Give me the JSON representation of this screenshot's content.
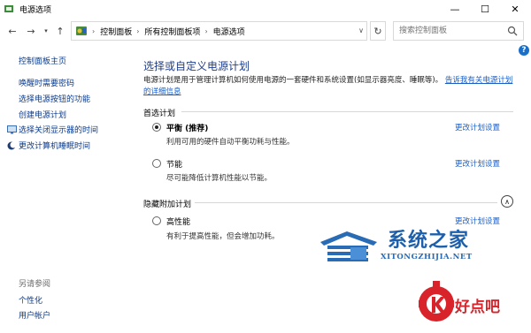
{
  "window": {
    "title": "电源选项",
    "buttons": {
      "minimize": "—",
      "maximize": "☐",
      "close": "✕"
    }
  },
  "nav": {
    "back_icon": "arrow-left-icon",
    "forward_icon": "arrow-right-icon",
    "recent_icon": "chevron-down-icon",
    "up_icon": "arrow-up-icon",
    "breadcrumbs": [
      "控制面板",
      "所有控制面板项",
      "电源选项"
    ],
    "refresh_icon": "refresh-icon",
    "search_placeholder": "搜索控制面板"
  },
  "sidebar": {
    "home": "控制面板主页",
    "items": [
      "唤醒时需要密码",
      "选择电源按钮的功能",
      "创建电源计划",
      "选择关闭显示器的时间",
      "更改计算机睡眠时间"
    ],
    "see_also": "另请参阅",
    "see_also_items": [
      "个性化",
      "用户帐户"
    ]
  },
  "main": {
    "title": "选择或自定义电源计划",
    "description": "电源计划是用于管理计算机如何使用电源的一套硬件和系统设置(如显示器亮度、睡眠等)。",
    "description_link": "告诉我有关电源计划的详细信息",
    "preferred_label": "首选计划",
    "hidden_label": "隐藏附加计划",
    "plans": [
      {
        "name": "平衡 (推荐)",
        "desc": "利用可用的硬件自动平衡功耗与性能。",
        "link": "更改计划设置",
        "selected": true
      },
      {
        "name": "节能",
        "desc": "尽可能降低计算机性能以节能。",
        "link": "更改计划设置",
        "selected": false
      },
      {
        "name": "高性能",
        "desc": "有利于提高性能，但会增加功耗。",
        "link": "更改计划设置",
        "selected": false
      }
    ]
  },
  "watermark": {
    "text": "系统之家",
    "sub": "XITONGZHIJIA.NET",
    "text2": "好点吧"
  },
  "colors": {
    "link": "#1a5fc7",
    "title": "#1e3e8c",
    "sidebar_link": "#0b3a8a",
    "watermark_blue": "#1d5faa",
    "watermark_red": "#d8232a"
  }
}
